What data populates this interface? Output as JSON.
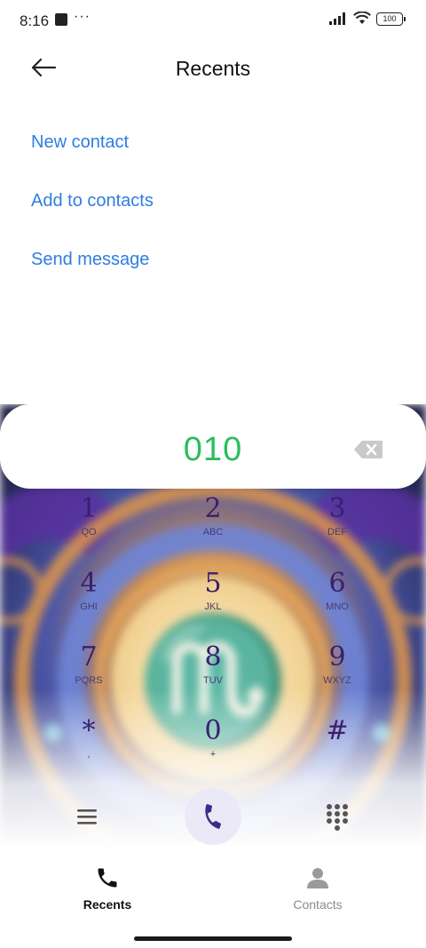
{
  "status_bar": {
    "time": "8:16",
    "overflow_dots": "···",
    "battery": "100"
  },
  "header": {
    "title": "Recents"
  },
  "actions": [
    {
      "label": "New contact"
    },
    {
      "label": "Add to contacts"
    },
    {
      "label": "Send message"
    }
  ],
  "dialer": {
    "number": "010",
    "keys": [
      {
        "digit": "1",
        "letters": "QO"
      },
      {
        "digit": "2",
        "letters": "ABC"
      },
      {
        "digit": "3",
        "letters": "DEF"
      },
      {
        "digit": "4",
        "letters": "GHI"
      },
      {
        "digit": "5",
        "letters": "JKL"
      },
      {
        "digit": "6",
        "letters": "MNO"
      },
      {
        "digit": "7",
        "letters": "PQRS"
      },
      {
        "digit": "8",
        "letters": "TUV"
      },
      {
        "digit": "9",
        "letters": "WXYZ"
      },
      {
        "digit": "*",
        "letters": ","
      },
      {
        "digit": "0",
        "letters": "+"
      },
      {
        "digit": "#",
        "letters": ""
      }
    ]
  },
  "bottom_nav": {
    "recents": "Recents",
    "contacts": "Contacts"
  },
  "colors": {
    "accent_blue": "#2f7de1",
    "number_green": "#2bbd5f",
    "digit_purple": "#3a1f6e"
  },
  "icons": [
    "back-arrow-icon",
    "signal-icon",
    "wifi-icon",
    "battery-icon",
    "backspace-icon",
    "menu-icon",
    "phone-icon",
    "keypad-icon",
    "contact-person-icon"
  ]
}
